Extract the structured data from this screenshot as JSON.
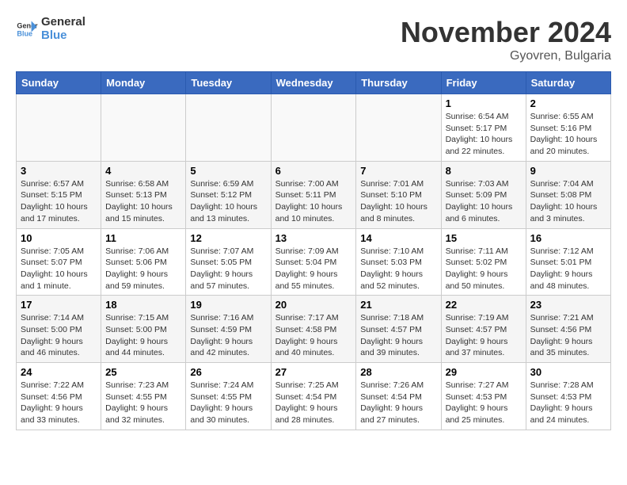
{
  "logo": {
    "line1": "General",
    "line2": "Blue"
  },
  "title": "November 2024",
  "location": "Gyovren, Bulgaria",
  "days_header": [
    "Sunday",
    "Monday",
    "Tuesday",
    "Wednesday",
    "Thursday",
    "Friday",
    "Saturday"
  ],
  "weeks": [
    [
      {
        "day": "",
        "info": ""
      },
      {
        "day": "",
        "info": ""
      },
      {
        "day": "",
        "info": ""
      },
      {
        "day": "",
        "info": ""
      },
      {
        "day": "",
        "info": ""
      },
      {
        "day": "1",
        "info": "Sunrise: 6:54 AM\nSunset: 5:17 PM\nDaylight: 10 hours\nand 22 minutes."
      },
      {
        "day": "2",
        "info": "Sunrise: 6:55 AM\nSunset: 5:16 PM\nDaylight: 10 hours\nand 20 minutes."
      }
    ],
    [
      {
        "day": "3",
        "info": "Sunrise: 6:57 AM\nSunset: 5:15 PM\nDaylight: 10 hours\nand 17 minutes."
      },
      {
        "day": "4",
        "info": "Sunrise: 6:58 AM\nSunset: 5:13 PM\nDaylight: 10 hours\nand 15 minutes."
      },
      {
        "day": "5",
        "info": "Sunrise: 6:59 AM\nSunset: 5:12 PM\nDaylight: 10 hours\nand 13 minutes."
      },
      {
        "day": "6",
        "info": "Sunrise: 7:00 AM\nSunset: 5:11 PM\nDaylight: 10 hours\nand 10 minutes."
      },
      {
        "day": "7",
        "info": "Sunrise: 7:01 AM\nSunset: 5:10 PM\nDaylight: 10 hours\nand 8 minutes."
      },
      {
        "day": "8",
        "info": "Sunrise: 7:03 AM\nSunset: 5:09 PM\nDaylight: 10 hours\nand 6 minutes."
      },
      {
        "day": "9",
        "info": "Sunrise: 7:04 AM\nSunset: 5:08 PM\nDaylight: 10 hours\nand 3 minutes."
      }
    ],
    [
      {
        "day": "10",
        "info": "Sunrise: 7:05 AM\nSunset: 5:07 PM\nDaylight: 10 hours\nand 1 minute."
      },
      {
        "day": "11",
        "info": "Sunrise: 7:06 AM\nSunset: 5:06 PM\nDaylight: 9 hours\nand 59 minutes."
      },
      {
        "day": "12",
        "info": "Sunrise: 7:07 AM\nSunset: 5:05 PM\nDaylight: 9 hours\nand 57 minutes."
      },
      {
        "day": "13",
        "info": "Sunrise: 7:09 AM\nSunset: 5:04 PM\nDaylight: 9 hours\nand 55 minutes."
      },
      {
        "day": "14",
        "info": "Sunrise: 7:10 AM\nSunset: 5:03 PM\nDaylight: 9 hours\nand 52 minutes."
      },
      {
        "day": "15",
        "info": "Sunrise: 7:11 AM\nSunset: 5:02 PM\nDaylight: 9 hours\nand 50 minutes."
      },
      {
        "day": "16",
        "info": "Sunrise: 7:12 AM\nSunset: 5:01 PM\nDaylight: 9 hours\nand 48 minutes."
      }
    ],
    [
      {
        "day": "17",
        "info": "Sunrise: 7:14 AM\nSunset: 5:00 PM\nDaylight: 9 hours\nand 46 minutes."
      },
      {
        "day": "18",
        "info": "Sunrise: 7:15 AM\nSunset: 5:00 PM\nDaylight: 9 hours\nand 44 minutes."
      },
      {
        "day": "19",
        "info": "Sunrise: 7:16 AM\nSunset: 4:59 PM\nDaylight: 9 hours\nand 42 minutes."
      },
      {
        "day": "20",
        "info": "Sunrise: 7:17 AM\nSunset: 4:58 PM\nDaylight: 9 hours\nand 40 minutes."
      },
      {
        "day": "21",
        "info": "Sunrise: 7:18 AM\nSunset: 4:57 PM\nDaylight: 9 hours\nand 39 minutes."
      },
      {
        "day": "22",
        "info": "Sunrise: 7:19 AM\nSunset: 4:57 PM\nDaylight: 9 hours\nand 37 minutes."
      },
      {
        "day": "23",
        "info": "Sunrise: 7:21 AM\nSunset: 4:56 PM\nDaylight: 9 hours\nand 35 minutes."
      }
    ],
    [
      {
        "day": "24",
        "info": "Sunrise: 7:22 AM\nSunset: 4:56 PM\nDaylight: 9 hours\nand 33 minutes."
      },
      {
        "day": "25",
        "info": "Sunrise: 7:23 AM\nSunset: 4:55 PM\nDaylight: 9 hours\nand 32 minutes."
      },
      {
        "day": "26",
        "info": "Sunrise: 7:24 AM\nSunset: 4:55 PM\nDaylight: 9 hours\nand 30 minutes."
      },
      {
        "day": "27",
        "info": "Sunrise: 7:25 AM\nSunset: 4:54 PM\nDaylight: 9 hours\nand 28 minutes."
      },
      {
        "day": "28",
        "info": "Sunrise: 7:26 AM\nSunset: 4:54 PM\nDaylight: 9 hours\nand 27 minutes."
      },
      {
        "day": "29",
        "info": "Sunrise: 7:27 AM\nSunset: 4:53 PM\nDaylight: 9 hours\nand 25 minutes."
      },
      {
        "day": "30",
        "info": "Sunrise: 7:28 AM\nSunset: 4:53 PM\nDaylight: 9 hours\nand 24 minutes."
      }
    ]
  ]
}
